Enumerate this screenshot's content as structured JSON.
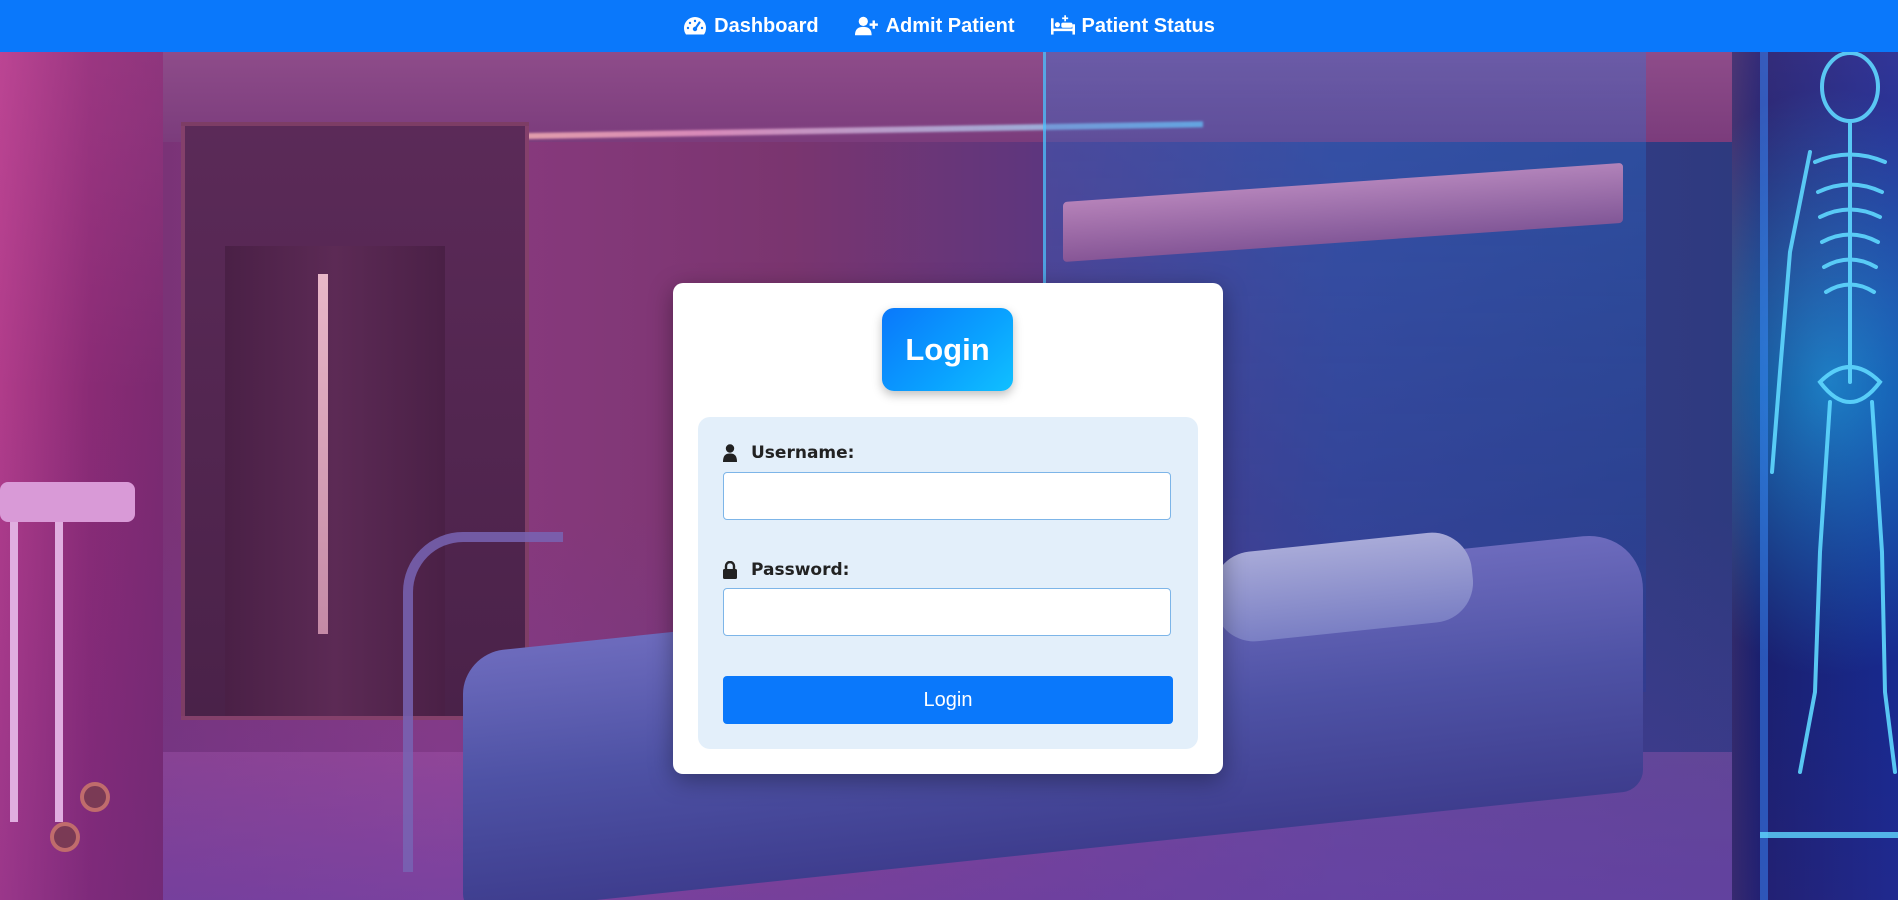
{
  "nav": {
    "items": [
      {
        "label": "Dashboard",
        "icon": "dashboard-gauge-icon"
      },
      {
        "label": "Admit Patient",
        "icon": "user-plus-icon"
      },
      {
        "label": "Patient Status",
        "icon": "hospital-bed-icon"
      }
    ],
    "color": "#0a78fb"
  },
  "login": {
    "title": "Login",
    "username": {
      "label": "Username:",
      "value": "",
      "icon": "user-icon"
    },
    "password": {
      "label": "Password:",
      "value": "",
      "icon": "lock-icon"
    },
    "submit_label": "Login"
  },
  "background": {
    "description_icon": "hospital-room-background"
  }
}
